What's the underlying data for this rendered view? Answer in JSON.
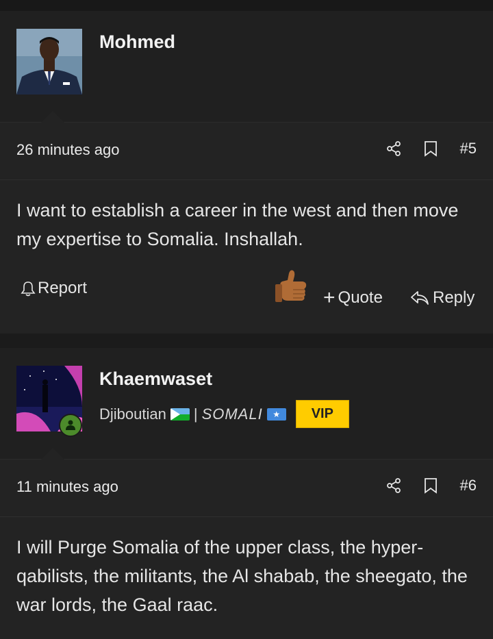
{
  "posts": [
    {
      "username": "Mohmed",
      "time": "26 minutes ago",
      "post_number": "#5",
      "body": "I want to establish a career in the west and then move my expertise to Somalia. Inshallah.",
      "actions": {
        "report": "Report",
        "quote": "Quote",
        "reply": "Reply"
      },
      "icons": [
        "share-icon",
        "bookmark-icon",
        "bell-icon",
        "thumbs-up-icon",
        "reply-arrow-icon"
      ]
    },
    {
      "username": "Khaemwaset",
      "user_title": {
        "prefix": "Djiboutian",
        "separator": "|",
        "somali": "SOMALI",
        "badge": "VIP"
      },
      "online": true,
      "time": "11 minutes ago",
      "post_number": "#6",
      "body": "I will Purge Somalia of the upper class, the hyper-qabilists, the militants, the Al shabab, the sheegato, the war lords, the Gaal raac.",
      "icons": [
        "share-icon",
        "bookmark-icon",
        "online-user-icon"
      ]
    }
  ],
  "colors": {
    "background": "#1b1b1b",
    "vip": "#ffcc00",
    "online": "#4c8b2b"
  }
}
